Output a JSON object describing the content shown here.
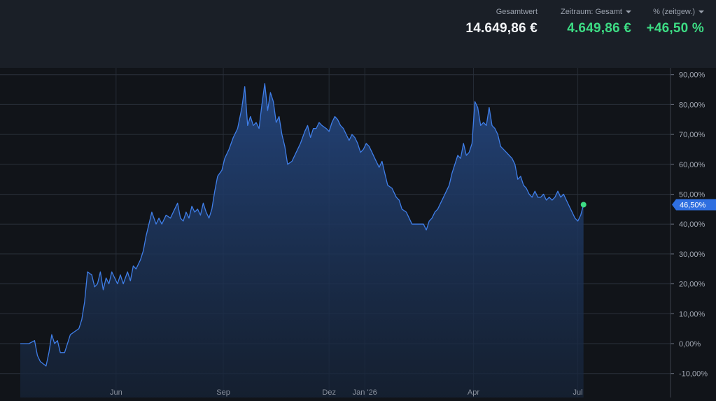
{
  "header": {
    "total_value": {
      "label": "Gesamtwert",
      "value": "14.649,86 €"
    },
    "period": {
      "label": "Zeitraum: Gesamt",
      "value": "4.649,86 €"
    },
    "percent": {
      "label": "% (zeitgew.)",
      "value": "+46,50 %"
    }
  },
  "colors": {
    "line": "#3f7ee8",
    "positive": "#3ddc84",
    "badge": "#2f6fe0",
    "background": "#111419",
    "header_bg": "#1a1f27"
  },
  "chart_data": {
    "type": "area",
    "title": "",
    "xlabel": "",
    "ylabel": "",
    "ylim": [
      -12,
      92
    ],
    "y_ticks": [
      -10,
      0,
      10,
      20,
      30,
      40,
      50,
      60,
      70,
      80,
      90
    ],
    "y_tick_labels": [
      "-10,00%",
      "0,00%",
      "10,00%",
      "20,00%",
      "30,00%",
      "40,00%",
      "50,00%",
      "60,00%",
      "70,00%",
      "80,00%",
      "90,00%"
    ],
    "x_range": [
      0,
      447
    ],
    "x_ticks": [
      67,
      142,
      216,
      241,
      317,
      390
    ],
    "x_tick_labels": [
      "Jun",
      "Sep",
      "Dez",
      "Jan '26",
      "Apr",
      "Jul"
    ],
    "grid": true,
    "current_label": "46,50%",
    "series": [
      {
        "values": [
          [
            0,
            0
          ],
          [
            6,
            0
          ],
          [
            10,
            1
          ],
          [
            12,
            -4
          ],
          [
            14,
            -6
          ],
          [
            18,
            -7.5
          ],
          [
            20,
            -3
          ],
          [
            22,
            3
          ],
          [
            24,
            0
          ],
          [
            26,
            1
          ],
          [
            28,
            -3
          ],
          [
            31,
            -3
          ],
          [
            35,
            3
          ],
          [
            38,
            4
          ],
          [
            41,
            5
          ],
          [
            43,
            8
          ],
          [
            45,
            14
          ],
          [
            47,
            24
          ],
          [
            50,
            23
          ],
          [
            52,
            19
          ],
          [
            54,
            20
          ],
          [
            56,
            24
          ],
          [
            58,
            18
          ],
          [
            60,
            22
          ],
          [
            62,
            20
          ],
          [
            64,
            24
          ],
          [
            66,
            22
          ],
          [
            68,
            20
          ],
          [
            70,
            23
          ],
          [
            72,
            20
          ],
          [
            75,
            24
          ],
          [
            77,
            21
          ],
          [
            79,
            26
          ],
          [
            81,
            25
          ],
          [
            84,
            28
          ],
          [
            86,
            31
          ],
          [
            88,
            36
          ],
          [
            90,
            40
          ],
          [
            92,
            44
          ],
          [
            95,
            40
          ],
          [
            97,
            42
          ],
          [
            99,
            40
          ],
          [
            102,
            43
          ],
          [
            105,
            42
          ],
          [
            108,
            45
          ],
          [
            110,
            47
          ],
          [
            112,
            42
          ],
          [
            114,
            41
          ],
          [
            116,
            44
          ],
          [
            118,
            42
          ],
          [
            120,
            46
          ],
          [
            122,
            44
          ],
          [
            124,
            45
          ],
          [
            126,
            43
          ],
          [
            128,
            47
          ],
          [
            130,
            44
          ],
          [
            132,
            42
          ],
          [
            134,
            45
          ],
          [
            136,
            51
          ],
          [
            138,
            56
          ],
          [
            141,
            58
          ],
          [
            143,
            62
          ],
          [
            146,
            65
          ],
          [
            149,
            69
          ],
          [
            152,
            72
          ],
          [
            155,
            79
          ],
          [
            157,
            86
          ],
          [
            159,
            73
          ],
          [
            161,
            76
          ],
          [
            163,
            73
          ],
          [
            165,
            74
          ],
          [
            167,
            72
          ],
          [
            169,
            80
          ],
          [
            171,
            87
          ],
          [
            173,
            78
          ],
          [
            175,
            84
          ],
          [
            177,
            81
          ],
          [
            179,
            74
          ],
          [
            181,
            76
          ],
          [
            183,
            70
          ],
          [
            185,
            66
          ],
          [
            187,
            60
          ],
          [
            190,
            61
          ],
          [
            193,
            64
          ],
          [
            196,
            67
          ],
          [
            199,
            71
          ],
          [
            201,
            73
          ],
          [
            203,
            69
          ],
          [
            205,
            72
          ],
          [
            207,
            72
          ],
          [
            209,
            74
          ],
          [
            211,
            73
          ],
          [
            214,
            72
          ],
          [
            216,
            71
          ],
          [
            218,
            74
          ],
          [
            220,
            76
          ],
          [
            222,
            75
          ],
          [
            224,
            73
          ],
          [
            226,
            72
          ],
          [
            228,
            70
          ],
          [
            230,
            68
          ],
          [
            232,
            70
          ],
          [
            234,
            69
          ],
          [
            236,
            67
          ],
          [
            238,
            64
          ],
          [
            240,
            65
          ],
          [
            242,
            67
          ],
          [
            244,
            66
          ],
          [
            246,
            64
          ],
          [
            248,
            62
          ],
          [
            251,
            59
          ],
          [
            253,
            61
          ],
          [
            255,
            57
          ],
          [
            257,
            53
          ],
          [
            260,
            52
          ],
          [
            263,
            49
          ],
          [
            265,
            48
          ],
          [
            267,
            45
          ],
          [
            270,
            44
          ],
          [
            272,
            42
          ],
          [
            274,
            40
          ],
          [
            277,
            40
          ],
          [
            280,
            40
          ],
          [
            282,
            40
          ],
          [
            284,
            38
          ],
          [
            286,
            41
          ],
          [
            288,
            42
          ],
          [
            290,
            44
          ],
          [
            292,
            45
          ],
          [
            294,
            47
          ],
          [
            296,
            49
          ],
          [
            298,
            51
          ],
          [
            300,
            53
          ],
          [
            302,
            57
          ],
          [
            304,
            60
          ],
          [
            306,
            63
          ],
          [
            308,
            62
          ],
          [
            310,
            67
          ],
          [
            312,
            63
          ],
          [
            314,
            64
          ],
          [
            316,
            67
          ],
          [
            318,
            81
          ],
          [
            320,
            79
          ],
          [
            322,
            73
          ],
          [
            324,
            74
          ],
          [
            326,
            73
          ],
          [
            328,
            79
          ],
          [
            330,
            73
          ],
          [
            332,
            72
          ],
          [
            334,
            70
          ],
          [
            336,
            66
          ],
          [
            338,
            65
          ],
          [
            340,
            64
          ],
          [
            342,
            63
          ],
          [
            344,
            62
          ],
          [
            346,
            60
          ],
          [
            348,
            55
          ],
          [
            350,
            56
          ],
          [
            352,
            53
          ],
          [
            354,
            52
          ],
          [
            356,
            50
          ],
          [
            358,
            49
          ],
          [
            360,
            51
          ],
          [
            362,
            49
          ],
          [
            364,
            49
          ],
          [
            366,
            50
          ],
          [
            368,
            48
          ],
          [
            370,
            49
          ],
          [
            372,
            48
          ],
          [
            374,
            49
          ],
          [
            376,
            51
          ],
          [
            378,
            49
          ],
          [
            380,
            50
          ],
          [
            382,
            48
          ],
          [
            384,
            46
          ],
          [
            386,
            44
          ],
          [
            388,
            42
          ],
          [
            390,
            41
          ],
          [
            392,
            43
          ],
          [
            394,
            46.5
          ]
        ]
      }
    ]
  }
}
